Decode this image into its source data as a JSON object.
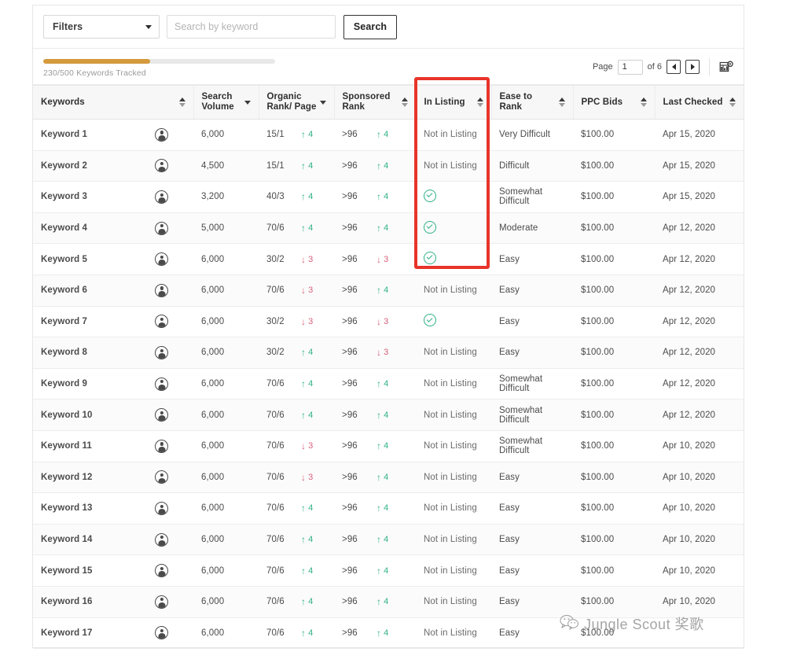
{
  "toolbar": {
    "filters_label": "Filters",
    "filters_icon": "chevron-down-icon",
    "search_placeholder": "Search by keyword",
    "search_value": "",
    "search_button": "Search"
  },
  "progress": {
    "label": "230/500 Keywords Tracked",
    "tracked": 230,
    "total": 500,
    "percent": 46,
    "fill_color": "#d59a3d",
    "track_color": "#e8e8e8"
  },
  "pagination": {
    "page_word": "Page",
    "page_value": "1",
    "of_text": "of 6",
    "total_pages": 6,
    "prev_icon": "triangle-left-icon",
    "next_icon": "triangle-right-icon",
    "settings_icon": "table-settings-gear-icon"
  },
  "table": {
    "columns": [
      {
        "label": "Keywords",
        "sort": "double"
      },
      {
        "label": "Search Volume",
        "sort": "single"
      },
      {
        "label": "Organic Rank/ Page",
        "sort": "single"
      },
      {
        "label": "Sponsored Rank",
        "sort": "double"
      },
      {
        "label": "In Listing",
        "sort": "double"
      },
      {
        "label": "Ease to Rank",
        "sort": "double"
      },
      {
        "label": "PPC Bids",
        "sort": "double"
      },
      {
        "label": "Last Checked",
        "sort": "double"
      }
    ],
    "rows": [
      {
        "keyword": "Keyword 1",
        "search_volume": "6,000",
        "organic_rank": "15/1",
        "organic_delta": "4",
        "organic_dir": "up",
        "sponsored_rank": ">96",
        "sponsored_delta": "4",
        "sponsored_dir": "up",
        "in_listing": "Not in Listing",
        "in_listing_check": false,
        "ease_to_rank": "Very Difficult",
        "ppc_bid": "$100.00",
        "last_checked": "Apr 15, 2020"
      },
      {
        "keyword": "Keyword 2",
        "search_volume": "4,500",
        "organic_rank": "15/1",
        "organic_delta": "4",
        "organic_dir": "up",
        "sponsored_rank": ">96",
        "sponsored_delta": "4",
        "sponsored_dir": "up",
        "in_listing": "Not in Listing",
        "in_listing_check": false,
        "ease_to_rank": "Difficult",
        "ppc_bid": "$100.00",
        "last_checked": "Apr 15, 2020"
      },
      {
        "keyword": "Keyword 3",
        "search_volume": "3,200",
        "organic_rank": "40/3",
        "organic_delta": "4",
        "organic_dir": "up",
        "sponsored_rank": ">96",
        "sponsored_delta": "4",
        "sponsored_dir": "up",
        "in_listing": "",
        "in_listing_check": true,
        "ease_to_rank": "Somewhat Difficult",
        "ppc_bid": "$100.00",
        "last_checked": "Apr 15, 2020"
      },
      {
        "keyword": "Keyword 4",
        "search_volume": "5,000",
        "organic_rank": "70/6",
        "organic_delta": "4",
        "organic_dir": "up",
        "sponsored_rank": ">96",
        "sponsored_delta": "4",
        "sponsored_dir": "up",
        "in_listing": "",
        "in_listing_check": true,
        "ease_to_rank": "Moderate",
        "ppc_bid": "$100.00",
        "last_checked": "Apr 12, 2020"
      },
      {
        "keyword": "Keyword 5",
        "search_volume": "6,000",
        "organic_rank": "30/2",
        "organic_delta": "3",
        "organic_dir": "down",
        "sponsored_rank": ">96",
        "sponsored_delta": "3",
        "sponsored_dir": "down",
        "in_listing": "",
        "in_listing_check": true,
        "ease_to_rank": "Easy",
        "ppc_bid": "$100.00",
        "last_checked": "Apr 12, 2020"
      },
      {
        "keyword": "Keyword 6",
        "search_volume": "6,000",
        "organic_rank": "70/6",
        "organic_delta": "3",
        "organic_dir": "down",
        "sponsored_rank": ">96",
        "sponsored_delta": "4",
        "sponsored_dir": "up",
        "in_listing": "Not in Listing",
        "in_listing_check": false,
        "ease_to_rank": "Easy",
        "ppc_bid": "$100.00",
        "last_checked": "Apr 12, 2020"
      },
      {
        "keyword": "Keyword 7",
        "search_volume": "6,000",
        "organic_rank": "30/2",
        "organic_delta": "3",
        "organic_dir": "down",
        "sponsored_rank": ">96",
        "sponsored_delta": "3",
        "sponsored_dir": "down",
        "in_listing": "",
        "in_listing_check": true,
        "ease_to_rank": "Easy",
        "ppc_bid": "$100.00",
        "last_checked": "Apr 12, 2020"
      },
      {
        "keyword": "Keyword 8",
        "search_volume": "6,000",
        "organic_rank": "30/2",
        "organic_delta": "4",
        "organic_dir": "up",
        "sponsored_rank": ">96",
        "sponsored_delta": "3",
        "sponsored_dir": "down",
        "in_listing": "Not in Listing",
        "in_listing_check": false,
        "ease_to_rank": "Easy",
        "ppc_bid": "$100.00",
        "last_checked": "Apr 12, 2020"
      },
      {
        "keyword": "Keyword 9",
        "search_volume": "6,000",
        "organic_rank": "70/6",
        "organic_delta": "4",
        "organic_dir": "up",
        "sponsored_rank": ">96",
        "sponsored_delta": "4",
        "sponsored_dir": "up",
        "in_listing": "Not in Listing",
        "in_listing_check": false,
        "ease_to_rank": "Somewhat Difficult",
        "ppc_bid": "$100.00",
        "last_checked": "Apr 12, 2020"
      },
      {
        "keyword": "Keyword 10",
        "search_volume": "6,000",
        "organic_rank": "70/6",
        "organic_delta": "4",
        "organic_dir": "up",
        "sponsored_rank": ">96",
        "sponsored_delta": "4",
        "sponsored_dir": "up",
        "in_listing": "Not in Listing",
        "in_listing_check": false,
        "ease_to_rank": "Somewhat Difficult",
        "ppc_bid": "$100.00",
        "last_checked": "Apr 12, 2020"
      },
      {
        "keyword": "Keyword 11",
        "search_volume": "6,000",
        "organic_rank": "70/6",
        "organic_delta": "3",
        "organic_dir": "down",
        "sponsored_rank": ">96",
        "sponsored_delta": "4",
        "sponsored_dir": "up",
        "in_listing": "Not in Listing",
        "in_listing_check": false,
        "ease_to_rank": "Somewhat Difficult",
        "ppc_bid": "$100.00",
        "last_checked": "Apr 10, 2020"
      },
      {
        "keyword": "Keyword 12",
        "search_volume": "6,000",
        "organic_rank": "70/6",
        "organic_delta": "3",
        "organic_dir": "down",
        "sponsored_rank": ">96",
        "sponsored_delta": "4",
        "sponsored_dir": "up",
        "in_listing": "Not in Listing",
        "in_listing_check": false,
        "ease_to_rank": "Easy",
        "ppc_bid": "$100.00",
        "last_checked": "Apr 10, 2020"
      },
      {
        "keyword": "Keyword 13",
        "search_volume": "6,000",
        "organic_rank": "70/6",
        "organic_delta": "4",
        "organic_dir": "up",
        "sponsored_rank": ">96",
        "sponsored_delta": "4",
        "sponsored_dir": "up",
        "in_listing": "Not in Listing",
        "in_listing_check": false,
        "ease_to_rank": "Easy",
        "ppc_bid": "$100.00",
        "last_checked": "Apr 10, 2020"
      },
      {
        "keyword": "Keyword 14",
        "search_volume": "6,000",
        "organic_rank": "70/6",
        "organic_delta": "4",
        "organic_dir": "up",
        "sponsored_rank": ">96",
        "sponsored_delta": "4",
        "sponsored_dir": "up",
        "in_listing": "Not in Listing",
        "in_listing_check": false,
        "ease_to_rank": "Easy",
        "ppc_bid": "$100.00",
        "last_checked": "Apr 10, 2020"
      },
      {
        "keyword": "Keyword 15",
        "search_volume": "6,000",
        "organic_rank": "70/6",
        "organic_delta": "4",
        "organic_dir": "up",
        "sponsored_rank": ">96",
        "sponsored_delta": "4",
        "sponsored_dir": "up",
        "in_listing": "Not in Listing",
        "in_listing_check": false,
        "ease_to_rank": "Easy",
        "ppc_bid": "$100.00",
        "last_checked": "Apr 10, 2020"
      },
      {
        "keyword": "Keyword 16",
        "search_volume": "6,000",
        "organic_rank": "70/6",
        "organic_delta": "4",
        "organic_dir": "up",
        "sponsored_rank": ">96",
        "sponsored_delta": "4",
        "sponsored_dir": "up",
        "in_listing": "Not in Listing",
        "in_listing_check": false,
        "ease_to_rank": "Easy",
        "ppc_bid": "$100.00",
        "last_checked": "Apr 10, 2020"
      },
      {
        "keyword": "Keyword 17",
        "search_volume": "6,000",
        "organic_rank": "70/6",
        "organic_delta": "4",
        "organic_dir": "up",
        "sponsored_rank": ">96",
        "sponsored_delta": "4",
        "sponsored_dir": "up",
        "in_listing": "Not in Listing",
        "in_listing_check": false,
        "ease_to_rank": "Easy",
        "ppc_bid": "$100.00",
        "last_checked": ""
      }
    ]
  },
  "annotation": {
    "highlight_color": "#e8342a",
    "highlight_target": "In Listing"
  },
  "watermark": {
    "text": "Jungle Scout 奖歌",
    "icon": "wechat-icon"
  },
  "colors": {
    "up": "#2eb086",
    "down": "#d9607a",
    "accent_orange": "#d59a3d"
  }
}
